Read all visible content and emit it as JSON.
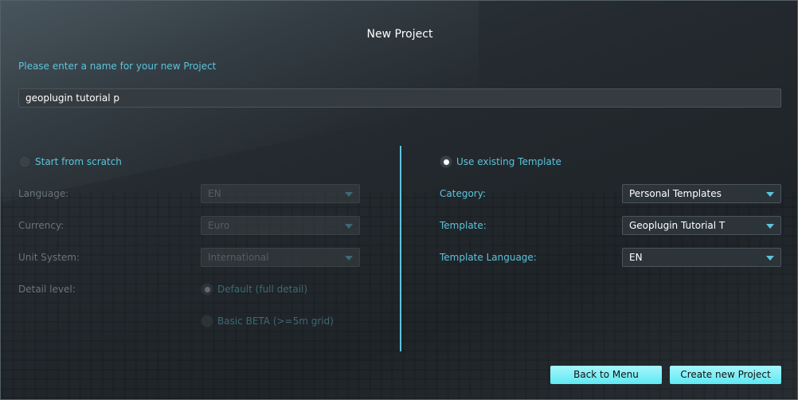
{
  "dialog": {
    "title": "New Project",
    "prompt": "Please enter a name for your new Project",
    "name_value": "geoplugin tutorial p"
  },
  "scratch": {
    "label": "Start from scratch",
    "selected": false,
    "fields": [
      {
        "label": "Language:",
        "value": "EN"
      },
      {
        "label": "Currency:",
        "value": "Euro"
      },
      {
        "label": "Unit System:",
        "value": "International"
      }
    ],
    "detail_label": "Detail level:",
    "detail_options": [
      {
        "label": "Default (full detail)",
        "selected": true
      },
      {
        "label": "Basic BETA (>=5m grid)",
        "selected": false
      }
    ]
  },
  "template": {
    "label": "Use existing Template",
    "selected": true,
    "fields": [
      {
        "label": "Category:",
        "value": "Personal Templates"
      },
      {
        "label": "Template:",
        "value": "Geoplugin Tutorial T"
      },
      {
        "label": "Template Language:",
        "value": "EN"
      }
    ]
  },
  "buttons": {
    "back": "Back to Menu",
    "create": "Create new Project"
  },
  "colors": {
    "accent": "#5cc4dc",
    "button": "#7ef0f6"
  }
}
